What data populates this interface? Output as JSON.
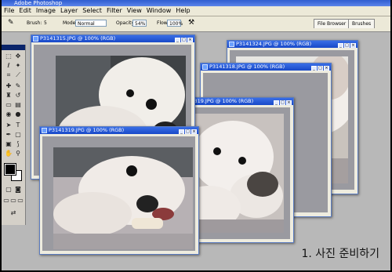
{
  "app": {
    "title": "Adobe Photoshop",
    "menu": [
      "File",
      "Edit",
      "Image",
      "Layer",
      "Select",
      "Filter",
      "View",
      "Window",
      "Help"
    ]
  },
  "options_bar": {
    "brush_label": "Brush:",
    "brush_size": "5",
    "mode_label": "Mode:",
    "mode_value": "Normal",
    "opacity_label": "Opacity:",
    "opacity_value": "54%",
    "flow_label": "Flow:",
    "flow_value": "100%",
    "tabs": [
      "File Browser",
      "Brushes"
    ]
  },
  "windows": [
    {
      "title": "P3141324.JPG @ 100% (RGB)"
    },
    {
      "title": "P3141318.JPG @ 100% (RGB)"
    },
    {
      "title": "P3141319.JPG @ 100% (RGB)"
    },
    {
      "title": "P3141315.JPG @ 100% (RGB)"
    },
    {
      "title": "P3141319.JPG @ 100% (RGB)"
    }
  ],
  "caption": "1. 사진 준비하기",
  "colors": {
    "title_blue": "#2e63d6",
    "chrome": "#ece9d8",
    "workspace": "#b8b8b8"
  }
}
